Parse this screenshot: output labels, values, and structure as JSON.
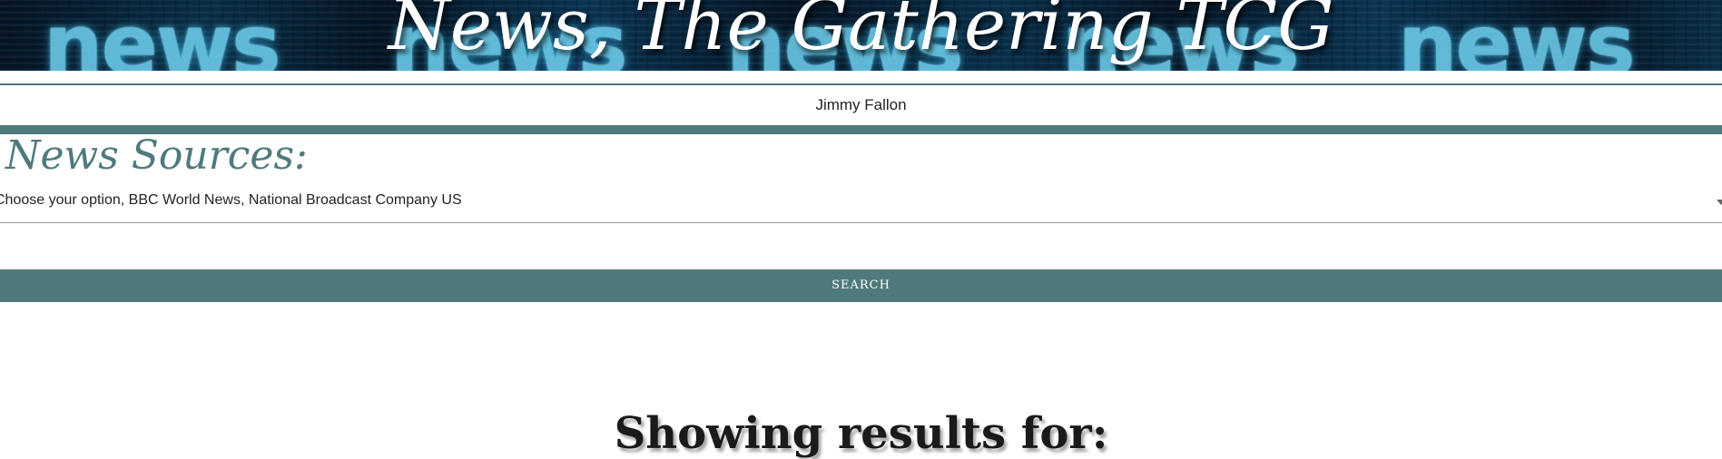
{
  "header": {
    "title": "News, The Gathering TCG",
    "banner_words": [
      "news",
      "news",
      "news",
      "news",
      "news"
    ]
  },
  "search": {
    "topic_value": "Jimmy Fallon"
  },
  "sources": {
    "label": "News Sources:",
    "selected_text": "Choose your option, BBC World News, National Broadcast Company US"
  },
  "actions": {
    "search_label": "SEARCH"
  },
  "results": {
    "heading": "Showing results for:"
  },
  "colors": {
    "accent": "#4f7a7d",
    "banner_glow": "#6fd3f2"
  }
}
